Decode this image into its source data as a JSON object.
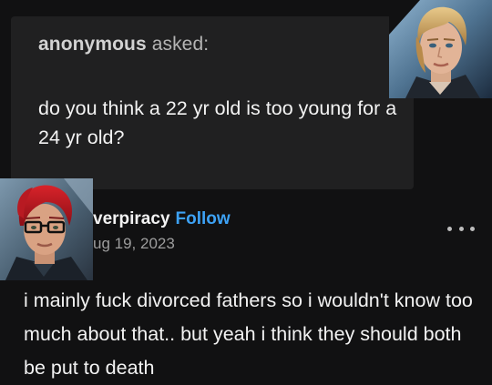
{
  "ask": {
    "asker": "anonymous",
    "asked_label": "asked:",
    "question": "do you think a 22 yr old is too young for a 24 yr old?"
  },
  "post": {
    "blog_name": "verpiracy",
    "follow_label": "Follow",
    "date": "ug 19, 2023",
    "body": "i mainly fuck divorced fathers so i wouldn't know too much about that.. but yeah i think they should both be put to death",
    "more_icon": "ellipsis-icon"
  },
  "colors": {
    "background": "#111112",
    "ask_box": "#202021",
    "follow_accent": "#3da2f5",
    "date_gray": "#9d9d9d"
  }
}
